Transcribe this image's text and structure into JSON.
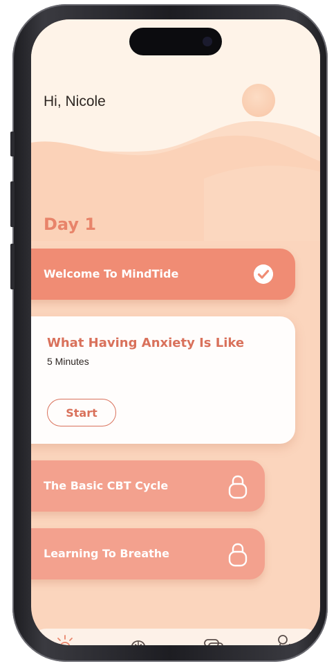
{
  "app": {
    "name": "MindTide"
  },
  "header": {
    "greeting": "Hi, Nicole"
  },
  "program": {
    "day_label": "Day 1",
    "completed_lesson": {
      "title": "Welcome To MindTide",
      "status_icon": "check-circle-icon"
    },
    "current_lesson": {
      "title": "What Having Anxiety Is Like",
      "duration": "5 Minutes",
      "start_label": "Start"
    },
    "locked_lessons": [
      {
        "title": "The Basic CBT Cycle",
        "status_icon": "lock-icon"
      },
      {
        "title": "Learning To Breathe",
        "status_icon": "lock-icon"
      }
    ]
  },
  "tab_bar": {
    "icons": [
      "sun-icon",
      "brain-icon",
      "chat-icon",
      "profile-icon"
    ]
  },
  "colors": {
    "accent": "#f08c74",
    "accent_dark": "#d9715b",
    "locked_card": "#f3a18e",
    "background": "#fbd5bd",
    "sky": "#fef3e8"
  }
}
